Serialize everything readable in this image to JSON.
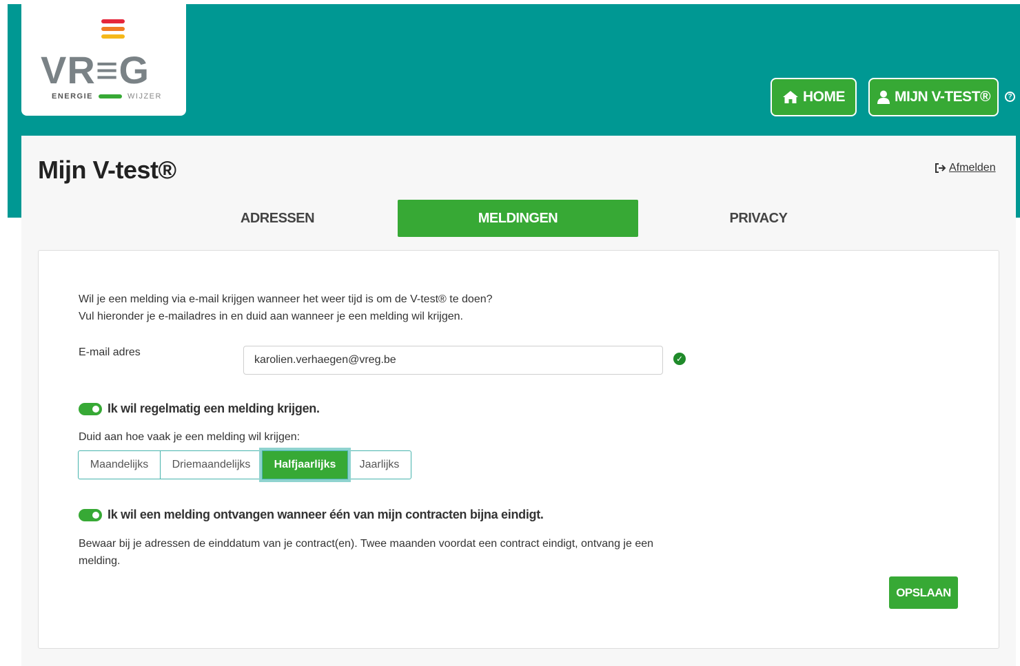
{
  "brand": {
    "logo_text": "VR≡G",
    "logo_sub_left": "ENERGIE",
    "logo_sub_right": "WIJZER",
    "colors": {
      "teal": "#009893",
      "green": "#37a935",
      "bar_red": "#e5263b",
      "bar_orange": "#f07c23",
      "bar_yellow": "#f5b819"
    }
  },
  "nav": {
    "home_label": "HOME",
    "mijn_label": "MIJN V-TEST®",
    "home_icon": "home-icon",
    "user_icon": "user-icon",
    "help_icon": "help-icon"
  },
  "header": {
    "title": "Mijn V-test®",
    "logout_label": "Afmelden"
  },
  "tabs": [
    {
      "label": "ADRESSEN",
      "active": false
    },
    {
      "label": "MELDINGEN",
      "active": true
    },
    {
      "label": "PRIVACY",
      "active": false
    }
  ],
  "meldingen": {
    "intro_line1": "Wil je een melding via e-mail krijgen wanneer het weer tijd is om de V-test® te doen?",
    "intro_line2": "Vul hieronder je e-mailadres in en duid aan wanneer je een melding wil krijgen.",
    "email_label": "E-mail adres",
    "email_value": "karolien.verhaegen@vreg.be",
    "toggle_regular_label": "Ik wil regelmatig een melding krijgen.",
    "toggle_regular_on": true,
    "frequency_label": "Duid aan hoe vaak je een melding wil krijgen:",
    "frequency_options": [
      "Maandelijks",
      "Driemaandelijks",
      "Halfjaarlijks",
      "Jaarlijks"
    ],
    "frequency_selected": "Halfjaarlijks",
    "toggle_contract_label": "Ik wil een melding ontvangen wanneer één van mijn contracten bijna eindigt.",
    "toggle_contract_on": true,
    "contract_text": "Bewaar bij je adressen de einddatum van je contract(en). Twee maanden voordat een contract eindigt, ontvang je een melding.",
    "save_label": "OPSLAAN"
  }
}
